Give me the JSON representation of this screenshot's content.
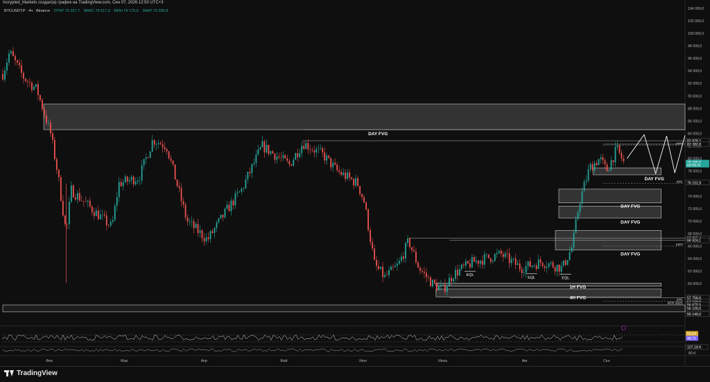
{
  "header": {
    "credit": "Incrypted_Markets создал(а) график на TradingView.com, Сен 07, 2026 12:50 UTC+3",
    "symbol": "BTCUSDT.P · 4ч · Binance",
    "ohlc": [
      "ОТКР 79 357,7",
      "МАКС 79 517,3",
      "МИН 79 175,5",
      "ЗАКР 79 395,8"
    ]
  },
  "brand": "TradingView",
  "colors": {
    "up": "#26a69a",
    "down": "#ef5350",
    "zone_fill": "#3a3a3a",
    "zone_stroke": "#d0d0d0",
    "ob_fill": "#2b2b2b"
  },
  "chart_data": {
    "type": "candlestick",
    "ylim": [
      54600,
      104200
    ],
    "ylim_unit": "USDT",
    "x_labels": [
      "Фев",
      "Мар",
      "Апр",
      "Май",
      "Июн",
      "Июль",
      "Авг",
      "Сен"
    ],
    "y_ticks": [
      "104 000,0",
      "102 000,0",
      "100 000,0",
      "98 000,0",
      "96 000,0",
      "94 000,0",
      "92 000,0",
      "90 000,0",
      "88 000,0",
      "86 000,0",
      "84 000,0",
      "82 000,0",
      "80 000,0",
      "78 000,0",
      "76 000,0",
      "74 000,0",
      "72 000,0",
      "70 000,0",
      "68 000,0",
      "66 000,0",
      "64 000,0",
      "62 000,0",
      "60 000,0",
      "58 000,0",
      "56 000,0"
    ],
    "y_tick_values": [
      104000,
      102000,
      100000,
      98000,
      96000,
      94000,
      92000,
      90000,
      88000,
      86000,
      84000,
      82000,
      80000,
      78000,
      76000,
      74000,
      72000,
      70000,
      68000,
      66000,
      64000,
      62000,
      60000,
      58000,
      56000
    ],
    "price_badges": [
      {
        "label": "79 395,8",
        "value": 79395.8,
        "color": "#26a69a"
      },
      {
        "label": "02:09:31",
        "value": 78950,
        "color": "#26a69a"
      }
    ],
    "level_labels": [
      {
        "label": "82 828,7",
        "value": 82828.7
      },
      {
        "label": "82 282,8",
        "value": 82282.8
      },
      {
        "label": "76 151,9",
        "value": 76151.9
      },
      {
        "label": "67 255,4",
        "value": 67255.4
      },
      {
        "label": "66 924,1",
        "value": 66924.1
      },
      {
        "label": "57 756,6",
        "value": 57756.6
      },
      {
        "label": "57 100,0",
        "value": 57100
      },
      {
        "label": "56 670,5",
        "value": 56670.5
      },
      {
        "label": "56 100,0",
        "value": 56100
      },
      {
        "label": "55 140,0",
        "value": 55140
      }
    ],
    "zones": [
      {
        "label": "DAY FVG",
        "top": 88700,
        "bottom": 84600,
        "x_from": 0.06,
        "x_to": 1.0
      },
      {
        "label": "DAY FVG",
        "top": 78500,
        "bottom": 77400,
        "x_from": 0.865,
        "x_to": 0.965
      },
      {
        "label": "DAY FVG",
        "top": 75100,
        "bottom": 72900,
        "x_from": 0.815,
        "x_to": 0.965
      },
      {
        "label": "DAY FVG",
        "top": 72400,
        "bottom": 70500,
        "x_from": 0.815,
        "x_to": 0.965
      },
      {
        "label": "DAY FVG",
        "top": 68500,
        "bottom": 65400,
        "x_from": 0.81,
        "x_to": 0.965
      },
      {
        "label": "1H FVG",
        "top": 60100,
        "bottom": 59600,
        "x_from": 0.635,
        "x_to": 0.965
      },
      {
        "label": "4H FVG",
        "top": 59150,
        "bottom": 57900,
        "x_from": 0.635,
        "x_to": 0.965
      }
    ],
    "ath_zone": {
      "label": "ATH 2021",
      "top": 56600,
      "bottom": 55500
    },
    "levels": [
      {
        "label": "pWH",
        "value": 82100
      },
      {
        "label": "pWL",
        "value": 76000
      },
      {
        "label": "pWH",
        "value": 66000
      },
      {
        "label": "pWL",
        "value": 57200
      }
    ],
    "eql_labels": [
      "EQL",
      "EQL",
      "EQL"
    ],
    "oscillator": {
      "badges": [
        {
          "label": "55,54",
          "color": "#d4a72c"
        },
        {
          "label": "48,71",
          "color": "#7b61ff"
        }
      ]
    },
    "volume_badge": {
      "label": "107,18 K"
    },
    "volume_ticks": [
      "80 K"
    ]
  }
}
